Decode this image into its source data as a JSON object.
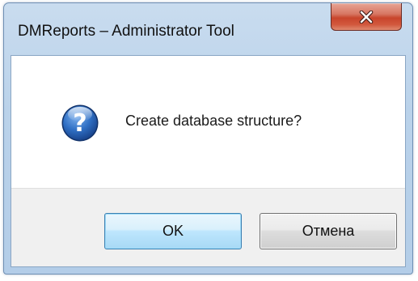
{
  "window": {
    "title": "DMReports – Administrator Tool"
  },
  "titlebar": {
    "close_icon": "close-icon"
  },
  "message": {
    "icon": "question-icon",
    "text": "Create database structure?"
  },
  "buttons": {
    "ok_label": "OK",
    "cancel_label": "Отмена"
  },
  "colors": {
    "frame": "#bad2ea",
    "close_button": "#c8452c",
    "question_icon": "#1f5fb5",
    "default_button_border": "#3c7fb1",
    "button_bar": "#f0f0f0"
  }
}
